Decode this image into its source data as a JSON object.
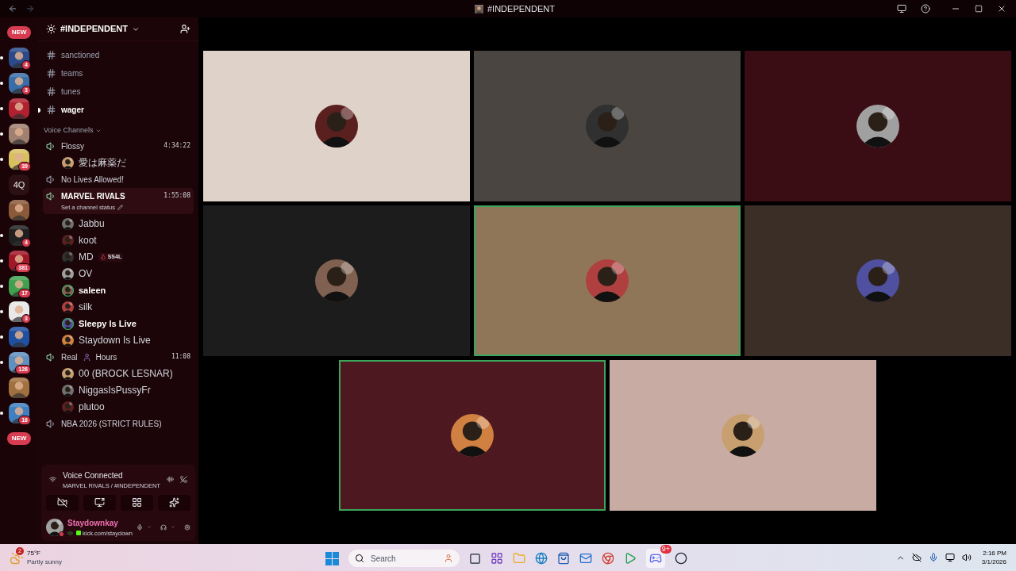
{
  "title_bar": {
    "title": "#INDEPENDENT"
  },
  "servers": [
    {
      "kind": "pill",
      "label": "NEW",
      "unread": false
    },
    {
      "kind": "icon",
      "color": "#2a4a8a",
      "badge": "4",
      "unread": true
    },
    {
      "kind": "icon",
      "color": "#3a6ea8",
      "badge": "3",
      "unread": true
    },
    {
      "kind": "icon",
      "color": "#b02030",
      "unread": true
    },
    {
      "kind": "icon",
      "color": "#a08070",
      "unread": true
    },
    {
      "kind": "icon",
      "color": "#d8c060",
      "badge": "39",
      "unread": true
    },
    {
      "kind": "text",
      "label": "4Q",
      "unread": false
    },
    {
      "kind": "icon",
      "color": "#8a5a3a",
      "unread": false
    },
    {
      "kind": "icon",
      "color": "#202020",
      "badge": "4",
      "unread": true
    },
    {
      "kind": "icon",
      "color": "#a01828",
      "badge": "381",
      "unread": true
    },
    {
      "kind": "icon",
      "color": "#40a050",
      "badge": "17",
      "unread": true
    },
    {
      "kind": "icon",
      "color": "#e8e8e8",
      "badge": "3",
      "unread": true
    },
    {
      "kind": "icon",
      "color": "#2050a0",
      "unread": true
    },
    {
      "kind": "icon",
      "color": "#6090c0",
      "badge": "126",
      "unread": true
    },
    {
      "kind": "icon",
      "color": "#a07040",
      "unread": false
    },
    {
      "kind": "icon",
      "color": "#4080c0",
      "badge": "16",
      "unread": true
    },
    {
      "kind": "pill",
      "label": "NEW",
      "unread": false
    }
  ],
  "server_name": "#INDEPENDENT",
  "text_channels": [
    {
      "name": "sanctioned",
      "unread": false
    },
    {
      "name": "teams",
      "unread": false
    },
    {
      "name": "tunes",
      "unread": false
    },
    {
      "name": "wager",
      "unread": true
    }
  ],
  "voice_header": "Voice Channels",
  "voice_channels": [
    {
      "name": "Flossy",
      "timer": "4:34:22",
      "active": false,
      "members": [
        {
          "name": "愛は麻薬だ",
          "speaking": false
        }
      ]
    },
    {
      "name": "No Lives Allowed!",
      "active": false
    },
    {
      "name": "MARVEL RIVALS",
      "timer": "1:55:08",
      "status": "Set a channel status",
      "active": true,
      "members": [
        {
          "name": "Jabbu",
          "speaking": false
        },
        {
          "name": "koot",
          "speaking": false
        },
        {
          "name": "MD",
          "tag": "SS4L",
          "speaking": false
        },
        {
          "name": "OV",
          "speaking": false
        },
        {
          "name": "saleen",
          "speaking": true
        },
        {
          "name": "silk",
          "speaking": false
        },
        {
          "name": "Sleepy Is Live",
          "speaking": true
        },
        {
          "name": "Staydown Is Live",
          "speaking": false
        }
      ]
    },
    {
      "name": "Real",
      "suffix": "Hours",
      "timer": "11:08",
      "active": false,
      "members": [
        {
          "name": "00 (BROCK LESNAR)",
          "speaking": false
        },
        {
          "name": "NiggasIsPussyFr",
          "speaking": false
        },
        {
          "name": "plutoo",
          "speaking": false
        }
      ]
    },
    {
      "name": "NBA 2026 (STRICT RULES)",
      "active": false
    }
  ],
  "voice_panel": {
    "status": "Voice Connected",
    "channel": "MARVEL RIVALS / #INDEPENDENT"
  },
  "user": {
    "name": "Staydownkay",
    "activity": "kick.com/staydown"
  },
  "tiles": [
    {
      "color": "#dfd2c8",
      "speaking": false
    },
    {
      "color": "#4a4540",
      "speaking": false
    },
    {
      "color": "#3a0c14",
      "speaking": false
    },
    {
      "color": "#1c1c1c",
      "speaking": false
    },
    {
      "color": "#8f7658",
      "speaking": true
    },
    {
      "color": "#3a2e26",
      "speaking": false
    },
    {
      "color": "#4e1820",
      "speaking": true
    },
    {
      "color": "#c8aca4",
      "speaking": false
    }
  ],
  "taskbar": {
    "weather_badge": "2",
    "temperature": "75°F",
    "condition": "Partly sunny",
    "search_placeholder": "Search",
    "time": "2:16 PM",
    "date": "3/1/2026",
    "discord_badge": "9+"
  }
}
